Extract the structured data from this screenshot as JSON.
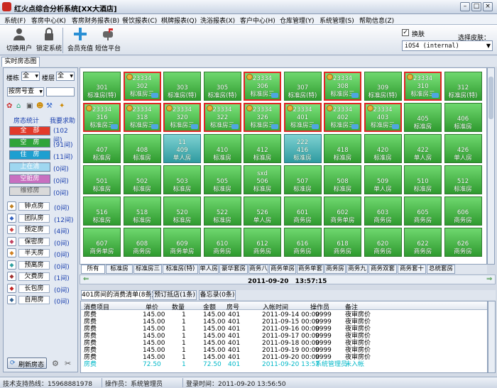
{
  "title": "红火点综合分析系统[XX大酒店]",
  "menu": [
    "系统(F)",
    "客房中心(K)",
    "客房财务报表(B)",
    "餐饮报表(C)",
    "棋牌报表(Q)",
    "洗浴报表(X)",
    "客户中心(H)",
    "仓库管理(Y)",
    "系统管理(S)",
    "帮助信息(Z)"
  ],
  "toolbar": {
    "switch_user": "切换用户",
    "lock_system": "锁定系统",
    "member_recharge": "会员充值",
    "sms_platform": "短信平台",
    "skin_label": "换肤",
    "choose_skin": "选择皮肤：",
    "skin_value": "iOS4 (internal)"
  },
  "main_tab": "实时房态图",
  "filters": {
    "building_label": "楼栋",
    "building_value": "全",
    "floor_label": "楼层",
    "floor_value": "全",
    "search_mode": "按房号查",
    "search_value": ""
  },
  "status_header": {
    "left": "房态统计",
    "right": "我要求助"
  },
  "status_buttons": [
    {
      "label": "全　部",
      "count": "(102间)",
      "bg": "#e23a2a",
      "fg": "#ffffff"
    },
    {
      "label": "空　房",
      "count": "(91间)",
      "bg": "#2fa43a",
      "fg": "#ffffff"
    },
    {
      "label": "住　房",
      "count": "(11间)",
      "bg": "#1e9fd0",
      "fg": "#ffffff"
    },
    {
      "label": "上在清",
      "count": "(0间)",
      "bg": "#9fd7f0",
      "fg": "#ffffff"
    },
    {
      "label": "空脏房",
      "count": "(0间)",
      "bg": "#c86fc0",
      "fg": "#ffffff"
    },
    {
      "label": "维修房",
      "count": "(0间)",
      "bg": "#d9d9d9",
      "fg": "#555555"
    }
  ],
  "room_types": [
    {
      "icon": "clock-icon",
      "label": "钟点房",
      "count": "(0间)"
    },
    {
      "icon": "group-icon",
      "label": "团队房",
      "count": "(12间)"
    },
    {
      "icon": "reserve-icon",
      "label": "预定房",
      "count": "(4间)"
    },
    {
      "icon": "secret-icon",
      "label": "保密房",
      "count": "(0间)"
    },
    {
      "icon": "halfday-icon",
      "label": "半天房",
      "count": "(0间)"
    },
    {
      "icon": "leave-icon",
      "label": "预离房",
      "count": "(0间)"
    },
    {
      "icon": "arrears-icon",
      "label": "欠费房",
      "count": "(1间)"
    },
    {
      "icon": "longrent-icon",
      "label": "长包房",
      "count": "(0间)"
    },
    {
      "icon": "self-icon",
      "label": "自用房",
      "count": "(0间)"
    }
  ],
  "refresh_label": "刷新房态",
  "rooms": [
    {
      "top": "",
      "no": "301",
      "type": "标准房(特)",
      "s": "v"
    },
    {
      "top": "23334",
      "no": "302",
      "type": "标准房三",
      "s": "o"
    },
    {
      "top": "",
      "no": "303",
      "type": "标准房(特)",
      "s": "v"
    },
    {
      "top": "",
      "no": "305",
      "type": "标准房(特)",
      "s": "v"
    },
    {
      "top": "23334",
      "no": "306",
      "type": "标准房三",
      "s": "o"
    },
    {
      "top": "",
      "no": "307",
      "type": "标准房(特)",
      "s": "v"
    },
    {
      "top": "23334",
      "no": "308",
      "type": "标准房三",
      "s": "o"
    },
    {
      "top": "",
      "no": "309",
      "type": "标准房(特)",
      "s": "v"
    },
    {
      "top": "23334",
      "no": "310",
      "type": "标准房三",
      "s": "o"
    },
    {
      "top": "",
      "no": "312",
      "type": "标准房(特)",
      "s": "v"
    },
    {
      "top": "23334",
      "no": "316",
      "type": "标准房三",
      "s": "o"
    },
    {
      "top": "23334",
      "no": "318",
      "type": "标准房三",
      "s": "o"
    },
    {
      "top": "23334",
      "no": "320",
      "type": "标准房三",
      "s": "o"
    },
    {
      "top": "23334",
      "no": "322",
      "type": "标准房三",
      "s": "o"
    },
    {
      "top": "23334",
      "no": "326",
      "type": "标准房三",
      "s": "o"
    },
    {
      "top": "23334",
      "no": "401",
      "type": "标准房三",
      "s": "o"
    },
    {
      "top": "23334",
      "no": "402",
      "type": "标准房三",
      "s": "o"
    },
    {
      "top": "23334",
      "no": "403",
      "type": "标准房三",
      "s": "o"
    },
    {
      "top": "",
      "no": "405",
      "type": "标准房",
      "s": "v"
    },
    {
      "top": "",
      "no": "406",
      "type": "标准房",
      "s": "v"
    },
    {
      "top": "",
      "no": "407",
      "type": "标准房",
      "s": "v"
    },
    {
      "top": "",
      "no": "408",
      "type": "标准房",
      "s": "v"
    },
    {
      "top": "11",
      "no": "409",
      "type": "单人房",
      "s": "t"
    },
    {
      "top": "",
      "no": "410",
      "type": "标准房",
      "s": "v"
    },
    {
      "top": "",
      "no": "412",
      "type": "标准房",
      "s": "v"
    },
    {
      "top": "222",
      "no": "416",
      "type": "标准房",
      "s": "t"
    },
    {
      "top": "",
      "no": "418",
      "type": "标准房",
      "s": "v"
    },
    {
      "top": "",
      "no": "420",
      "type": "标准房",
      "s": "v"
    },
    {
      "top": "",
      "no": "422",
      "type": "单人房",
      "s": "v"
    },
    {
      "top": "",
      "no": "426",
      "type": "单人房",
      "s": "v"
    },
    {
      "top": "",
      "no": "501",
      "type": "标准房",
      "s": "v"
    },
    {
      "top": "",
      "no": "502",
      "type": "标准房",
      "s": "v"
    },
    {
      "top": "",
      "no": "503",
      "type": "标准房",
      "s": "v"
    },
    {
      "top": "",
      "no": "505",
      "type": "标准房",
      "s": "v"
    },
    {
      "top": "sxd",
      "no": "506",
      "type": "标准房",
      "s": "v"
    },
    {
      "top": "",
      "no": "507",
      "type": "标准房",
      "s": "v"
    },
    {
      "top": "",
      "no": "508",
      "type": "标准房",
      "s": "v"
    },
    {
      "top": "",
      "no": "509",
      "type": "单人房",
      "s": "v"
    },
    {
      "top": "",
      "no": "510",
      "type": "标准房",
      "s": "v"
    },
    {
      "top": "",
      "no": "512",
      "type": "标准房",
      "s": "v"
    },
    {
      "top": "",
      "no": "516",
      "type": "标准房",
      "s": "v"
    },
    {
      "top": "",
      "no": "518",
      "type": "标准房",
      "s": "v"
    },
    {
      "top": "",
      "no": "520",
      "type": "标准房",
      "s": "v"
    },
    {
      "top": "",
      "no": "522",
      "type": "标准房",
      "s": "v"
    },
    {
      "top": "",
      "no": "526",
      "type": "单人房",
      "s": "v"
    },
    {
      "top": "",
      "no": "601",
      "type": "商务房",
      "s": "v"
    },
    {
      "top": "",
      "no": "602",
      "type": "商务单房",
      "s": "v"
    },
    {
      "top": "",
      "no": "603",
      "type": "商务房",
      "s": "v"
    },
    {
      "top": "",
      "no": "605",
      "type": "商务房",
      "s": "v"
    },
    {
      "top": "",
      "no": "606",
      "type": "商务房",
      "s": "v"
    },
    {
      "top": "",
      "no": "607",
      "type": "商务单房",
      "s": "v"
    },
    {
      "top": "",
      "no": "608",
      "type": "商务房",
      "s": "v"
    },
    {
      "top": "",
      "no": "609",
      "type": "商务单房",
      "s": "v"
    },
    {
      "top": "",
      "no": "610",
      "type": "商务房",
      "s": "v"
    },
    {
      "top": "",
      "no": "612",
      "type": "商务房",
      "s": "v"
    },
    {
      "top": "",
      "no": "616",
      "type": "商务房",
      "s": "v"
    },
    {
      "top": "",
      "no": "618",
      "type": "商务房",
      "s": "v"
    },
    {
      "top": "",
      "no": "620",
      "type": "商务房",
      "s": "v"
    },
    {
      "top": "",
      "no": "622",
      "type": "商务房",
      "s": "v"
    },
    {
      "top": "",
      "no": "626",
      "type": "商务房",
      "s": "v"
    }
  ],
  "type_tabs": [
    "所有",
    "标准房",
    "标准房三",
    "标准房(特)",
    "单人房",
    "豪华套房",
    "商务八",
    "商务单房",
    "商务单套",
    "商务房",
    "商务九",
    "商务双套",
    "商务套十",
    "总统套房"
  ],
  "date_display": "2011-09-20　13:57:15",
  "bottom_tabs": [
    "401房间的消费清单(8条)",
    "预订抵店(1条)",
    "备忘录(0条)"
  ],
  "table": {
    "headers": [
      "消费项目",
      "单价",
      "数量",
      "金额",
      "房号",
      "入帐时间",
      "操作员",
      "备注"
    ],
    "rows": [
      [
        "房费",
        "145.00",
        "1",
        "145.00",
        "401",
        "2011-09-14 00:00",
        "9999",
        "夜审房价"
      ],
      [
        "房费",
        "145.00",
        "1",
        "145.00",
        "401",
        "2011-09-15 00:00",
        "9999",
        "夜审房价"
      ],
      [
        "房费",
        "145.00",
        "1",
        "145.00",
        "401",
        "2011-09-16 00:00",
        "9999",
        "夜审房价"
      ],
      [
        "房费",
        "145.00",
        "1",
        "145.00",
        "401",
        "2011-09-17 00:00",
        "9999",
        "夜审房价"
      ],
      [
        "房费",
        "145.00",
        "1",
        "145.00",
        "401",
        "2011-09-18 00:00",
        "9999",
        "夜审房价"
      ],
      [
        "房费",
        "145.00",
        "1",
        "145.00",
        "401",
        "2011-09-19 00:00",
        "9999",
        "夜审房价"
      ],
      [
        "房费",
        "145.00",
        "1",
        "145.00",
        "401",
        "2011-09-20 00:00",
        "9999",
        "夜审房价"
      ],
      [
        "房费",
        "72.50",
        "1",
        "72.50",
        "401",
        "2011-09-20 13:57",
        "系统管理员",
        "未入帐"
      ]
    ]
  },
  "status": {
    "hotline": "技术支持热线：15968881978",
    "operator": "操作员：系统管理员",
    "login_time": "登录时间：2011-09-20 13:56:50"
  }
}
